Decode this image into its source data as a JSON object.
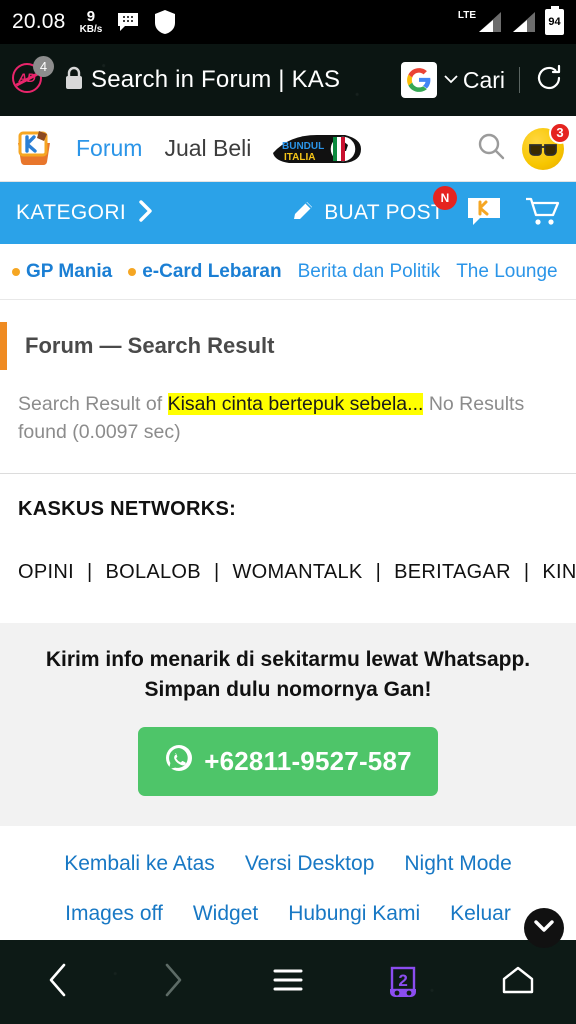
{
  "statusbar": {
    "clock": "20.08",
    "net_speed_value": "9",
    "net_speed_unit": "KB/s",
    "messaging_icon": "bbm-messenger-icon",
    "shield_icon": "shield-icon",
    "network_type": "LTE",
    "battery_percent": "94"
  },
  "browser": {
    "adblock_count": "4",
    "lock_icon": "lock-icon",
    "url_title": "Search in Forum | KAS",
    "search_engine_icon": "google-icon",
    "search_engine_label": "Cari",
    "reload_icon": "reload-icon"
  },
  "site_header": {
    "logo": "kaskus-logo",
    "nav_primary": "Forum",
    "nav_secondary": "Jual Beli",
    "banner_line1": "BUNDUL",
    "banner_line2": "ITALIA",
    "search_icon": "search-icon",
    "avatar_badge": "3",
    "accent_blue": "#2b95e8"
  },
  "bluebar": {
    "kategori_label": "KATEGORI",
    "chevron_icon": "chevron-right-icon",
    "buat_post_label": "BUAT POST",
    "pencil_icon": "pencil-icon",
    "buat_post_badge": "N",
    "chat_icon": "kaskus-chat-icon",
    "cart_icon": "cart-icon",
    "bg_color": "#2ba2e8"
  },
  "chips": [
    {
      "label": "GP Mania",
      "hot": true
    },
    {
      "label": "e-Card Lebaran",
      "hot": true
    },
    {
      "label": "Berita dan Politik",
      "hot": false
    },
    {
      "label": "The Lounge",
      "hot": false
    }
  ],
  "main": {
    "section_title": "Forum — Search Result",
    "accent_color": "#ef8b22",
    "result_prefix": "Search Result of ",
    "result_query": "Kisah cinta bertepuk sebela...",
    "result_suffix": " No Results found (0.0097 sec)",
    "highlight_color": "#ffff00"
  },
  "networks": {
    "title": "KASKUS NETWORKS:",
    "links": [
      "OPINI",
      "BOLALOB",
      "WOMANTALK",
      "BERITAGAR",
      "KINCIR"
    ],
    "separator": "|"
  },
  "whatsapp": {
    "line1": "Kirim info menarik di sekitarmu lewat Whatsapp.",
    "line2": "Simpan dulu nomornya Gan!",
    "icon": "whatsapp-icon",
    "phone": "+62811-9527-587",
    "button_color": "#4ec569"
  },
  "footer": {
    "row1": [
      "Kembali ke Atas",
      "Versi Desktop",
      "Night Mode"
    ],
    "row2": [
      "Images off",
      "Widget",
      "Hubungi Kami",
      "Keluar"
    ],
    "link_color": "#1878c4",
    "scroll_button_icon": "chevron-down-icon"
  },
  "bottom_toolbar": {
    "back_icon": "back-arrow-icon",
    "forward_icon": "forward-arrow-icon",
    "menu_icon": "hamburger-menu-icon",
    "tabs_count": "2",
    "tabs_icon": "incognito-tabs-icon",
    "home_icon": "home-icon"
  }
}
